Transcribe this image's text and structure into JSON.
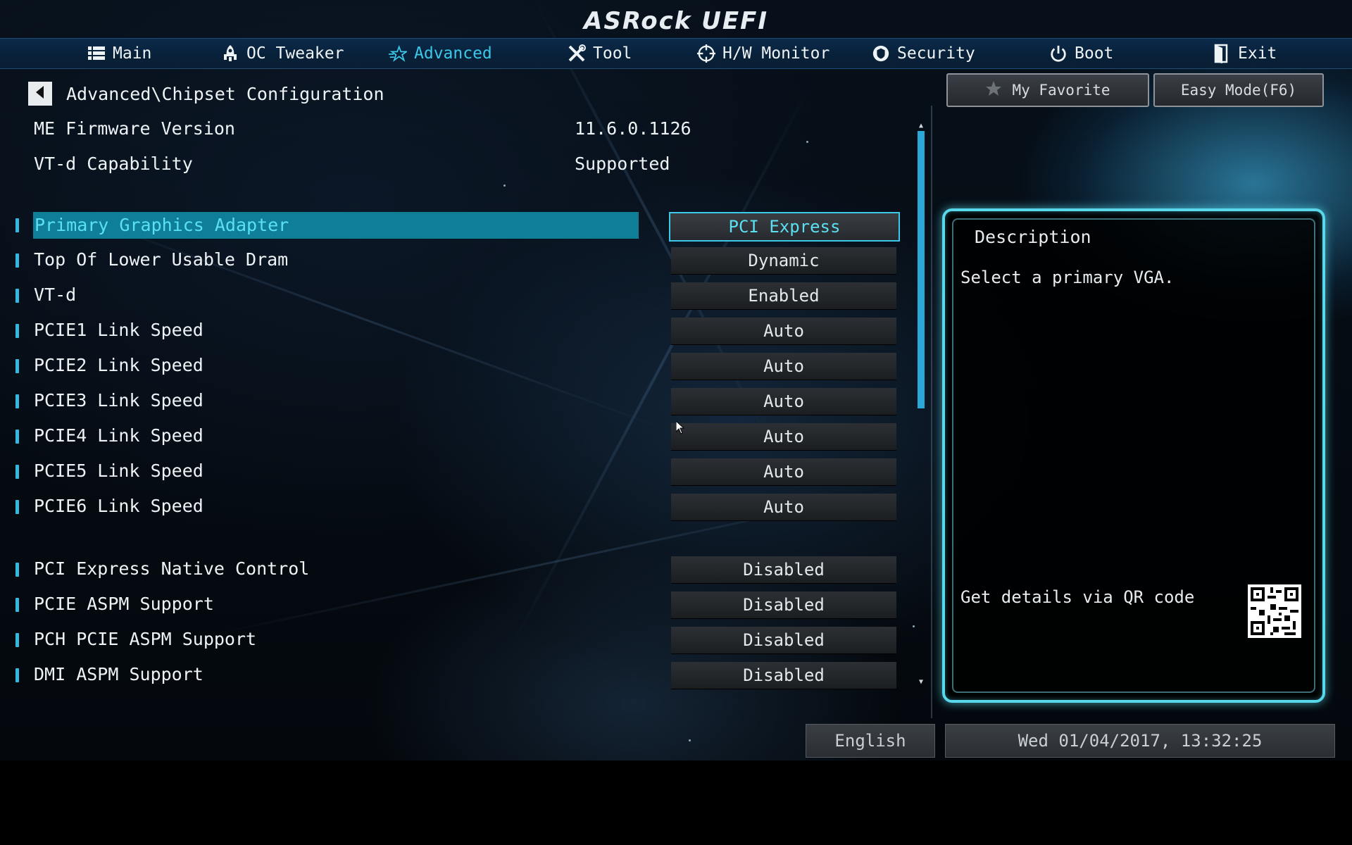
{
  "header": {
    "logo": "ASRock UEFI"
  },
  "nav": {
    "items": [
      {
        "label": "Main",
        "icon": "list-icon"
      },
      {
        "label": "OC Tweaker",
        "icon": "rocket-icon"
      },
      {
        "label": "Advanced",
        "icon": "star-icon",
        "active": true
      },
      {
        "label": "Tool",
        "icon": "tools-icon"
      },
      {
        "label": "H/W Monitor",
        "icon": "crosshair-icon"
      },
      {
        "label": "Security",
        "icon": "shield-icon"
      },
      {
        "label": "Boot",
        "icon": "power-icon"
      },
      {
        "label": "Exit",
        "icon": "exit-door-icon"
      }
    ],
    "active_color": "#3cc8e8"
  },
  "breadcrumb": {
    "path": "Advanced\\Chipset Configuration"
  },
  "top_buttons": {
    "favorite": "My Favorite",
    "easy_mode": "Easy Mode(F6)"
  },
  "info": [
    {
      "label": "ME Firmware Version",
      "value": "11.6.0.1126"
    },
    {
      "label": "VT-d Capability",
      "value": "Supported"
    }
  ],
  "settings_group1": [
    {
      "label": "Primary Graphics Adapter",
      "value": "PCI Express",
      "selected": true
    },
    {
      "label": "Top Of Lower Usable Dram",
      "value": "Dynamic"
    },
    {
      "label": "VT-d",
      "value": "Enabled"
    },
    {
      "label": "PCIE1 Link Speed",
      "value": "Auto"
    },
    {
      "label": "PCIE2 Link Speed",
      "value": "Auto"
    },
    {
      "label": "PCIE3 Link Speed",
      "value": "Auto"
    },
    {
      "label": "PCIE4 Link Speed",
      "value": "Auto"
    },
    {
      "label": "PCIE5 Link Speed",
      "value": "Auto"
    },
    {
      "label": "PCIE6 Link Speed",
      "value": "Auto"
    }
  ],
  "settings_group2": [
    {
      "label": "PCI Express Native Control",
      "value": "Disabled"
    },
    {
      "label": "PCIE ASPM Support",
      "value": "Disabled"
    },
    {
      "label": "PCH PCIE ASPM Support",
      "value": "Disabled"
    },
    {
      "label": "DMI ASPM Support",
      "value": "Disabled"
    }
  ],
  "description": {
    "title": "Description",
    "text": "Select a primary VGA.",
    "qr_text": "Get details via QR code"
  },
  "footer": {
    "language": "English",
    "datetime": "Wed 01/04/2017, 13:32:25"
  },
  "colors": {
    "accent": "#3cc8e8",
    "selected_bg": "#0f7f97",
    "panel_border": "#58d8ea"
  }
}
